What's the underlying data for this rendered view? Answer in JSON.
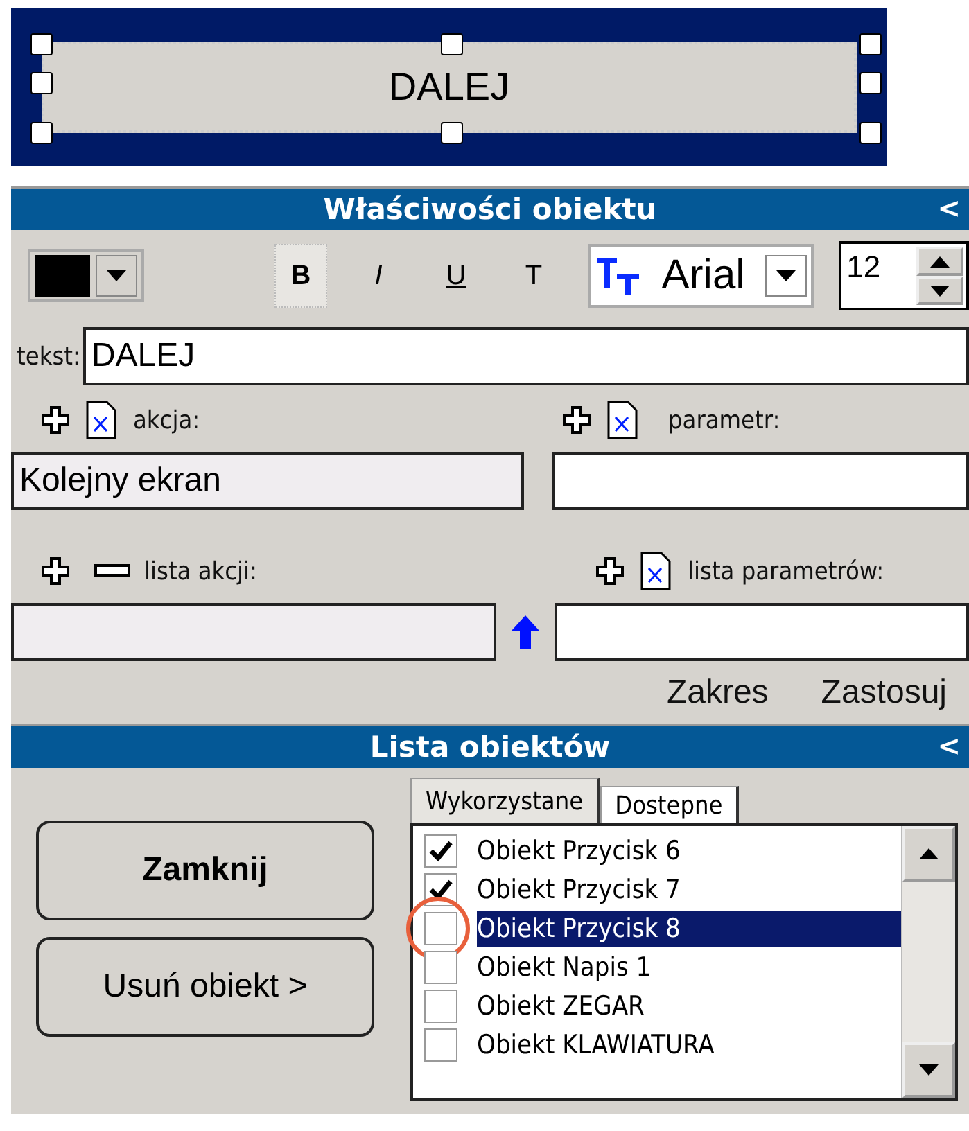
{
  "preview_button": {
    "label": "DALEJ"
  },
  "properties_panel": {
    "title": "Właściwości obiektu",
    "collapse": "<",
    "toolbar": {
      "color": "#000000",
      "styles": [
        {
          "label": "B",
          "selected": true
        },
        {
          "label": "I",
          "selected": false
        },
        {
          "label": "U",
          "selected": false
        },
        {
          "label": "T",
          "selected": false
        }
      ],
      "font": "Arial",
      "size": "12"
    },
    "text_field": {
      "label": "tekst:",
      "value": "DALEJ"
    },
    "action": {
      "label": "akcja:",
      "value": "Kolejny ekran"
    },
    "parameter": {
      "label": "parametr:"
    },
    "action_list": {
      "label": "lista akcji:"
    },
    "parameter_list": {
      "label": "lista parametrów:"
    },
    "links": [
      "Zakres",
      "Zastosuj"
    ]
  },
  "objects_panel": {
    "title": "Lista obiektów",
    "collapse": "<",
    "buttons": [
      "Zamknij",
      "Usuń obiekt >"
    ],
    "tabs": [
      {
        "label": "Wykorzystane",
        "selected": true
      },
      {
        "label": "Dostepne",
        "selected": false
      }
    ],
    "items": [
      {
        "label": "Obiekt Przycisk 6",
        "checked": true,
        "selected": false,
        "highlighted": false
      },
      {
        "label": "Obiekt Przycisk 7",
        "checked": true,
        "selected": false,
        "highlighted": false
      },
      {
        "label": "Obiekt Przycisk 8",
        "checked": false,
        "selected": true,
        "highlighted": true
      },
      {
        "label": "Obiekt Napis 1",
        "checked": false,
        "selected": false,
        "highlighted": false
      },
      {
        "label": "Obiekt ZEGAR",
        "checked": false,
        "selected": false,
        "highlighted": false
      },
      {
        "label": "Obiekt KLAWIATURA",
        "checked": false,
        "selected": false,
        "highlighted": false
      }
    ]
  }
}
